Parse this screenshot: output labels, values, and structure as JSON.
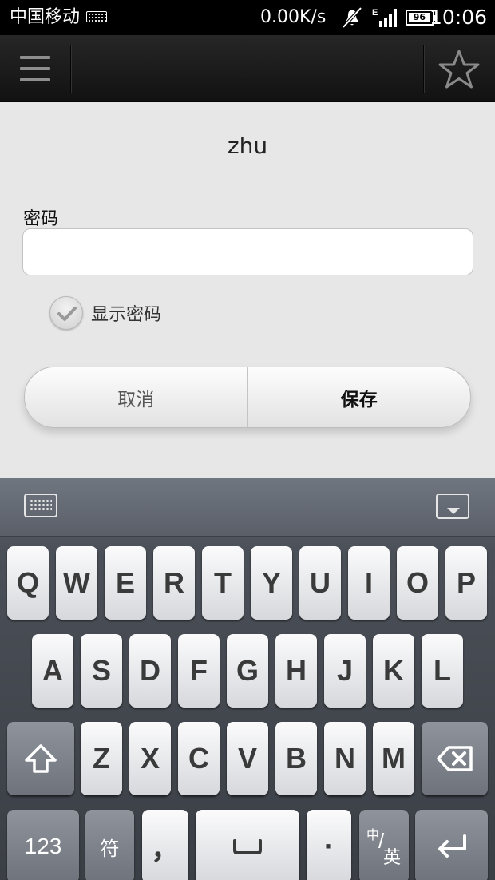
{
  "status_bar": {
    "carrier": "中国移动",
    "net_speed": "0.00K/s",
    "network_type": "E",
    "battery": "96",
    "time": "10:06",
    "icons": [
      "keyboard-icon",
      "mute-icon",
      "signal-icon",
      "battery-icon"
    ]
  },
  "action_bar": {
    "icons": [
      "menu-icon",
      "star-icon"
    ]
  },
  "dialog": {
    "title": "zhu",
    "password_label": "密码",
    "password_value": "",
    "show_password_label": "显示密码",
    "show_password_checked": true,
    "cancel_label": "取消",
    "save_label": "保存"
  },
  "keyboard": {
    "row1": [
      "Q",
      "W",
      "E",
      "R",
      "T",
      "Y",
      "U",
      "I",
      "O",
      "P"
    ],
    "row2": [
      "A",
      "S",
      "D",
      "F",
      "G",
      "H",
      "J",
      "K",
      "L"
    ],
    "row3": [
      "Z",
      "X",
      "C",
      "V",
      "B",
      "N",
      "M"
    ],
    "num_label": "123",
    "symbol_label": "符",
    "comma_label": "，",
    "period_label": "·",
    "lang_label_cn": "中",
    "lang_label_en": "英",
    "icons": [
      "keyboard-switch-icon",
      "hide-keyboard-icon",
      "shift-icon",
      "backspace-icon",
      "space-icon",
      "enter-icon"
    ]
  },
  "colors": {
    "action_bar": "#1a1a1a",
    "dialog_bg": "#e7e7e7",
    "keyboard_bg": "#4b5058"
  }
}
